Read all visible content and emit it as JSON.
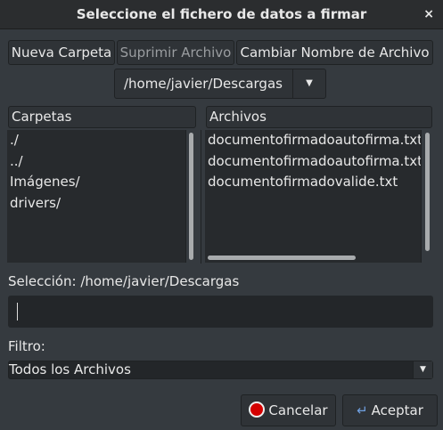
{
  "title": "Seleccione el fichero de datos a firmar",
  "close": "×",
  "toolbar": {
    "new_folder": "Nueva Carpeta",
    "delete_file": "Suprimir Archivo",
    "rename_file": "Cambiar Nombre de Archivo"
  },
  "path": "/home/javier/Descargas",
  "folders": {
    "header": "Carpetas",
    "items": [
      "./",
      "../",
      "Imágenes/",
      "drivers/"
    ]
  },
  "files": {
    "header": "Archivos",
    "items": [
      "documentofirmadoautofirma.txt",
      "documentofirmadoautofirma.txt",
      "documentofirmadovalide.txt"
    ]
  },
  "selection": {
    "label": "Selección: /home/javier/Descargas",
    "value": ""
  },
  "filter": {
    "label": "Filtro:",
    "value": "Todos los Archivos"
  },
  "buttons": {
    "cancel": "Cancelar",
    "ok": "Aceptar"
  }
}
